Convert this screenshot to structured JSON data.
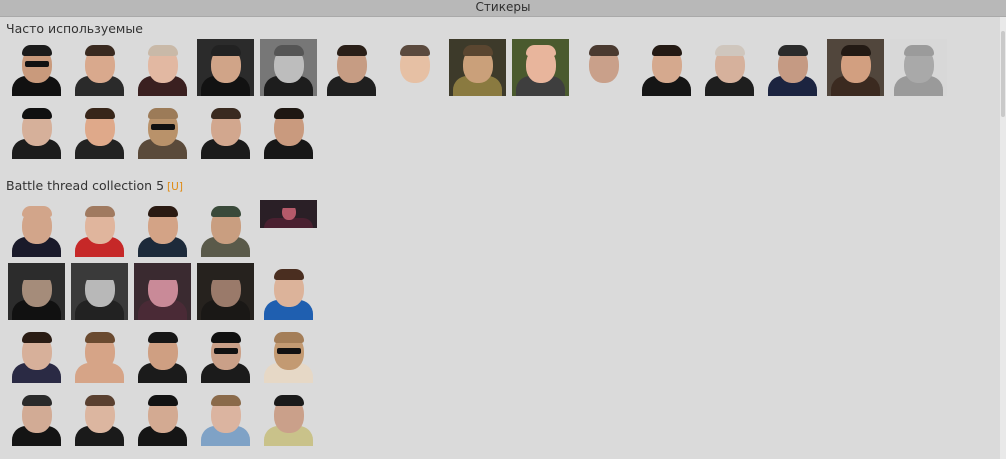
{
  "window": {
    "title": "Стикеры"
  },
  "sections": [
    {
      "title": "Часто используемые",
      "badge": "",
      "stickers": [
        {
          "icon": "man-sunglasses-sticker-icon",
          "bg": "",
          "skin": "#c99a7c",
          "shirt": "#111111",
          "hair": "#1b1b1b",
          "shades": true
        },
        {
          "icon": "laughing-man-sticker-icon",
          "bg": "",
          "skin": "#d9a98d",
          "shirt": "#2a2a2a",
          "hair": "#3a2a20",
          "shades": false
        },
        {
          "icon": "grinning-man-sticker-icon",
          "bg": "",
          "skin": "#e2b8a2",
          "shirt": "#3a2020",
          "hair": "#c9b9a8",
          "shades": false
        },
        {
          "icon": "man-in-suit-sticker-icon",
          "bg": "#2b2b2b",
          "skin": "#d0a488",
          "shirt": "#121212",
          "hair": "#222222",
          "shades": false
        },
        {
          "icon": "laughing-man-bw-sticker-icon",
          "bg": "#777777",
          "skin": "#bdbdbd",
          "shirt": "#1d1d1d",
          "hair": "#555555",
          "shades": false
        },
        {
          "icon": "pointing-man-sticker-icon",
          "bg": "",
          "skin": "#c69c83",
          "shirt": "#1f1f1f",
          "hair": "#2a1f18",
          "shades": false
        },
        {
          "icon": "man-face-sticker-icon",
          "bg": "",
          "skin": "#e6c0a4",
          "shirt": "#dadada",
          "hair": "#5b4a3e",
          "shades": false
        },
        {
          "icon": "lying-man-sticker-icon",
          "bg": "#3d3a2a",
          "skin": "#caa07a",
          "shirt": "#8a7a40",
          "hair": "#5a4630",
          "shades": false
        },
        {
          "icon": "bald-smiling-man-sticker-icon",
          "bg": "#4a5a2e",
          "skin": "#e8b59c",
          "shirt": "#3e3e3e",
          "hair": "#e8b59c",
          "shades": false
        },
        {
          "icon": "man-thinking-sticker-icon",
          "bg": "",
          "skin": "#c9a08a",
          "shirt": "#dadada",
          "hair": "#4a3a30",
          "shades": false
        },
        {
          "icon": "thumbs-up-man-sticker-icon",
          "bg": "",
          "skin": "#d5a98e",
          "shirt": "#151515",
          "hair": "#241a14",
          "shades": false
        },
        {
          "icon": "smirking-man-sticker-icon",
          "bg": "",
          "skin": "#d6b19c",
          "shirt": "#1e1e1e",
          "hair": "#cfc6bd",
          "shades": false
        },
        {
          "icon": "serious-man-sticker-icon",
          "bg": "",
          "skin": "#c59a83",
          "shirt": "#1c2440",
          "hair": "#2b2b2b",
          "shades": false
        },
        {
          "icon": "smiling-man-drink-sticker-icon",
          "bg": "#51463c",
          "skin": "#d29f80",
          "shirt": "#3b2a20",
          "hair": "#231a14",
          "shades": false
        },
        {
          "icon": "bald-man-bw-sticker-icon",
          "bg": "#d8d8d8",
          "skin": "#a9a9a9",
          "shirt": "#9a9a9a",
          "hair": "#9b9b9b",
          "shades": false
        },
        {
          "icon": "man-cap-sticker-icon",
          "bg": "",
          "skin": "#d6b09a",
          "shirt": "#1c1c1c",
          "hair": "#101010",
          "shades": false
        },
        {
          "icon": "chubby-man-sticker-icon",
          "bg": "",
          "skin": "#dfa98a",
          "shirt": "#222222",
          "hair": "#38261a",
          "shades": false
        },
        {
          "icon": "cougar-sunglasses-gun-sticker-icon",
          "bg": "",
          "skin": "#b9926a",
          "shirt": "#5a4a3a",
          "hair": "#9c7b58",
          "shades": true
        },
        {
          "icon": "man-black-tshirt-sticker-icon",
          "bg": "",
          "skin": "#d2a78e",
          "shirt": "#1b1b1b",
          "hair": "#3a2a20",
          "shades": false
        },
        {
          "icon": "bearded-man-sticker-icon",
          "bg": "",
          "skin": "#c99a7e",
          "shirt": "#171717",
          "hair": "#1e1712",
          "shades": false
        }
      ]
    },
    {
      "title": "Battle thread collection 5",
      "badge": "[U]",
      "stickers": [
        {
          "icon": "bearded-man-black-tshirt-sticker-icon",
          "bg": "",
          "skin": "#d2a58a",
          "shirt": "#1a1a2a",
          "hair": "#d2a58a",
          "shades": false
        },
        {
          "icon": "man-red-jacket-sticker-icon",
          "bg": "",
          "skin": "#e0b59d",
          "shirt": "#c62828",
          "hair": "#a07a60",
          "shades": false
        },
        {
          "icon": "smiling-bearded-man-sticker-icon",
          "bg": "",
          "skin": "#d3a386",
          "shirt": "#1d2a3a",
          "hair": "#2a1a12",
          "shades": false
        },
        {
          "icon": "man-beanie-sticker-icon",
          "bg": "",
          "skin": "#c99e80",
          "shirt": "#5a5a4a",
          "hair": "#3a4a3a",
          "shades": false
        },
        {
          "icon": "crowd-stage-sticker-icon",
          "bg": "#2a1f26",
          "skin": "#b55a6a",
          "shirt": "#4a2030",
          "hair": "#2a1f26",
          "shades": false,
          "wide": true
        },
        {
          "icon": "group-photo-dark-sticker-icon",
          "bg": "#2c2c2c",
          "skin": "#a58c7a",
          "shirt": "#111111",
          "hair": "#2c2c2c",
          "shades": false
        },
        {
          "icon": "group-photo-bw-sticker-icon",
          "bg": "#3a3a3a",
          "skin": "#b8b8b8",
          "shirt": "#222222",
          "hair": "#3a3a3a",
          "shades": false
        },
        {
          "icon": "crowd-pink-sticker-icon",
          "bg": "#3a2a30",
          "skin": "#c98a98",
          "shirt": "#4a2a36",
          "hair": "#3a2a30",
          "shades": false
        },
        {
          "icon": "crowd-dark-sticker-icon",
          "bg": "#26221e",
          "skin": "#9a7a6a",
          "shirt": "#1a1816",
          "hair": "#26221e",
          "shades": false
        },
        {
          "icon": "man-blue-shirt-sticker-icon",
          "bg": "",
          "skin": "#dcb39a",
          "shirt": "#1f5fb0",
          "hair": "#4a2e20",
          "shades": false
        },
        {
          "icon": "man-hand-face-sticker-icon",
          "bg": "",
          "skin": "#d7b09a",
          "shirt": "#2a2a44",
          "hair": "#2a1c14",
          "shades": false
        },
        {
          "icon": "shirtless-man-sticker-icon",
          "bg": "",
          "skin": "#d6a487",
          "shirt": "#d6a487",
          "hair": "#6a4a30",
          "shades": false
        },
        {
          "icon": "man-horns-sticker-icon",
          "bg": "",
          "skin": "#cf9f82",
          "shirt": "#1b1b1b",
          "hair": "#161616",
          "shades": false
        },
        {
          "icon": "man-cap-sunglasses-sticker-icon",
          "bg": "",
          "skin": "#caa088",
          "shirt": "#1b1b1b",
          "hair": "#111111",
          "shades": true
        },
        {
          "icon": "cougar-sunglasses-sticker-icon",
          "bg": "",
          "skin": "#c39a72",
          "shirt": "#e6d8c6",
          "hair": "#a47e58",
          "shades": true
        },
        {
          "icon": "man-black-jacket-sticker-icon",
          "bg": "",
          "skin": "#d2ab95",
          "shirt": "#141414",
          "hair": "#2a2a2a",
          "shades": false
        },
        {
          "icon": "man-ramones-tshirt-sticker-icon",
          "bg": "",
          "skin": "#dcb6a0",
          "shirt": "#1a1a1a",
          "hair": "#5a4030",
          "shades": false
        },
        {
          "icon": "man-cap-black-shirt-sticker-icon",
          "bg": "",
          "skin": "#d3aa92",
          "shirt": "#151515",
          "hair": "#121212",
          "shades": false
        },
        {
          "icon": "man-denim-jacket-sticker-icon",
          "bg": "",
          "skin": "#dbb4a0",
          "shirt": "#7fa2c6",
          "hair": "#8a6a4a",
          "shades": false
        },
        {
          "icon": "crouching-man-sticker-icon",
          "bg": "",
          "skin": "#caa08a",
          "shirt": "#c9c28a",
          "hair": "#1a1a1a",
          "shades": false
        }
      ]
    }
  ]
}
